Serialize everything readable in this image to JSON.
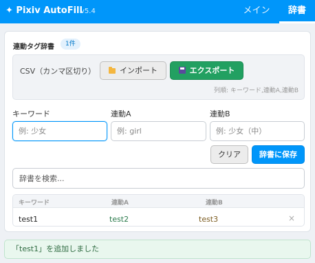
{
  "header": {
    "title": "✦ Pixiv AutoFill",
    "version": "v5.4",
    "tabs": [
      {
        "label": "メイン",
        "active": false
      },
      {
        "label": "辞書",
        "active": true
      }
    ]
  },
  "dictionary": {
    "section_title": "連動タグ辞書",
    "count_badge": "1件",
    "csv": {
      "label": "CSV（カンマ区切り）",
      "import_label": "インポート",
      "export_label": "エクスポート",
      "hint": "列順: キーワード,連動A,連動B"
    },
    "fields": {
      "keyword": {
        "label": "キーワード",
        "placeholder": "例: 少女",
        "value": ""
      },
      "link_a": {
        "label": "連動A",
        "placeholder": "例: girl",
        "value": ""
      },
      "link_b": {
        "label": "連動B",
        "placeholder": "例: 少女（中）",
        "value": ""
      }
    },
    "clear_label": "クリア",
    "save_label": "辞書に保存",
    "search": {
      "placeholder": "辞書を検索...",
      "value": ""
    },
    "table": {
      "headers": [
        "キーワード",
        "連動A",
        "連動B"
      ],
      "rows": [
        {
          "keyword": "test1",
          "link_a": "test2",
          "link_b": "test3",
          "delete": "×"
        }
      ]
    }
  },
  "toast": "「test1」を追加しました",
  "colors": {
    "accent": "#0096fa",
    "export_green": "#22a061",
    "toast_bg": "#e9f7ee"
  },
  "icons": [
    "sparkle-icon",
    "folder-icon",
    "floppy-disk-icon",
    "close-icon"
  ]
}
